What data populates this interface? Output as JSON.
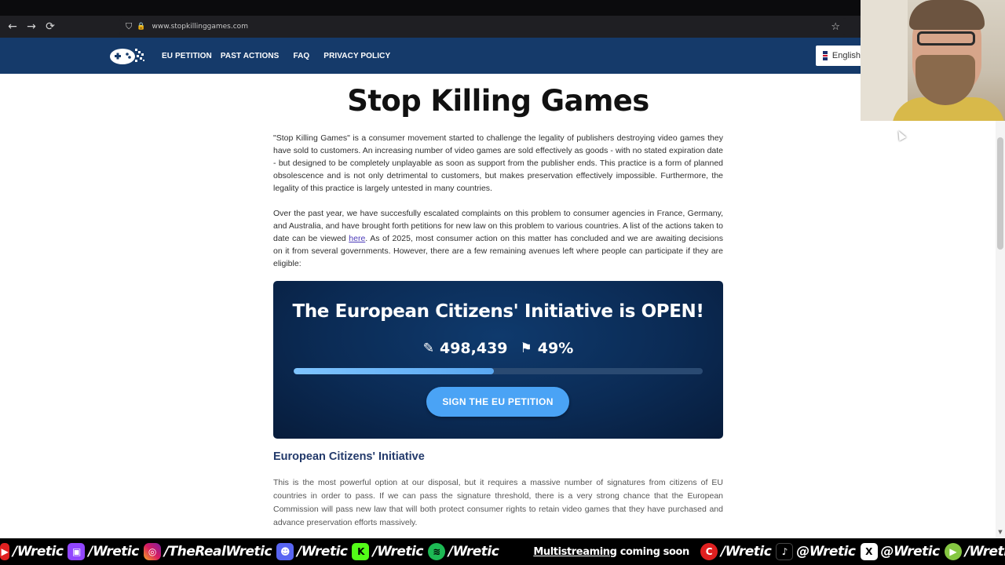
{
  "browser": {
    "url": "www.stopkillinggames.com",
    "back_icon": "←",
    "forward_icon": "→",
    "reload_icon": "⟳",
    "shield_icon": "⛉",
    "lock_icon": "🔒",
    "bookmark_icon": "☆"
  },
  "nav": {
    "links": [
      "EU PETITION",
      "PAST ACTIONS",
      "FAQ",
      "PRIVACY POLICY"
    ],
    "language": "English"
  },
  "page": {
    "title": "Stop Killing Games",
    "paragraph1": "\"Stop Killing Games\" is a consumer movement started to challenge the legality of publishers destroying video games they have sold to customers. An increasing number of video games are sold effectively as goods - with no stated expiration date - but designed to be completely unplayable as soon as support from the publisher ends. This practice is a form of planned obsolescence and is not only detrimental to customers, but makes preservation effectively impossible. Furthermore, the legality of this practice is largely untested in many countries.",
    "paragraph2_before": "Over the past year, we have succesfully escalated complaints on this problem to consumer agencies in France, Germany, and Australia, and have brought forth petitions for new law on this problem to various countries. A list of the actions taken to date can be viewed ",
    "paragraph2_link": "here",
    "paragraph2_after": ". As of 2025, most consumer action on this matter has concluded and we are awaiting decisions on it from several governments. However, there are a few remaining avenues left where people can participate if they are eligible:",
    "banner": {
      "title": "The European Citizens' Initiative is OPEN!",
      "signatures": "498,439",
      "percent": "49%",
      "progress_fraction": 0.49,
      "pencil_icon": "✎",
      "flag_icon": "⚑",
      "button": "SIGN THE EU PETITION"
    },
    "section_heading": "European Citizens' Initiative",
    "paragraph3": "This is the most powerful option at our disposal, but it requires a massive number of signatures from citizens of EU countries in order to pass. If we can pass the signature threshold, there is a very strong chance that the European Commission will pass new law that will both protect consumer rights to retain video games that they have purchased and advance preservation efforts massively."
  },
  "footer": {
    "items": [
      {
        "icon": "youtube-icon",
        "glyph": "▶",
        "text": "/Wretic"
      },
      {
        "icon": "twitch-icon",
        "glyph": "▣",
        "text": "/Wretic"
      },
      {
        "icon": "instagram-icon",
        "glyph": "◎",
        "text": "/TheRealWretic"
      },
      {
        "icon": "discord-icon",
        "glyph": "☻",
        "text": "/Wretic"
      },
      {
        "icon": "kick-icon",
        "glyph": "K",
        "text": "/Wretic"
      },
      {
        "icon": "spotify-icon",
        "glyph": "≋",
        "text": "/Wretic"
      }
    ],
    "multistream_underlined": "Multistreaming",
    "multistream_rest": " coming soon",
    "items2": [
      {
        "icon": "kick-circle-icon",
        "glyph": "C",
        "text": "/Wretic"
      },
      {
        "icon": "tiktok-icon",
        "glyph": "♪",
        "text": "@Wretic"
      },
      {
        "icon": "x-icon",
        "glyph": "X",
        "text": "@Wretic"
      },
      {
        "icon": "rumble-icon",
        "glyph": "▶",
        "text": "/Wretic"
      }
    ]
  }
}
